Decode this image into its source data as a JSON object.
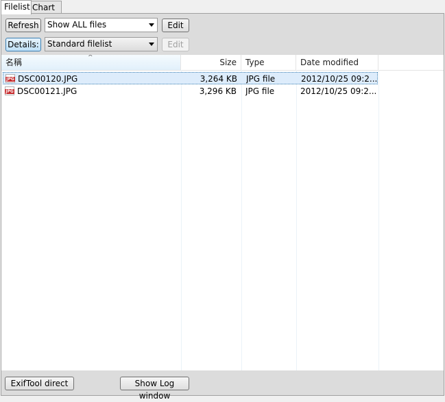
{
  "tabs": [
    "Filelist",
    "Chart"
  ],
  "toolbar": {
    "refresh_label": "Refresh",
    "filter_value": "Show ALL files",
    "edit1_label": "Edit",
    "details_label": "Details:",
    "view_value": "Standard filelist",
    "edit2_label": "Edit"
  },
  "columns": [
    "名稱",
    "Size",
    "Type",
    "Date modified"
  ],
  "files": [
    {
      "name": "DSC00120.JPG",
      "size": "3,264 KB",
      "type": "JPG file",
      "date": "2012/10/25 09:2..."
    },
    {
      "name": "DSC00121.JPG",
      "size": "3,296 KB",
      "type": "JPG file",
      "date": "2012/10/25 09:2..."
    }
  ],
  "bottom": {
    "exiftool_label": "ExifTool direct",
    "log_label": "Show Log window"
  },
  "colors": {
    "selection": "#ddecfb",
    "accent": "#3c7fb1",
    "jpg_icon": "#c4282a"
  }
}
